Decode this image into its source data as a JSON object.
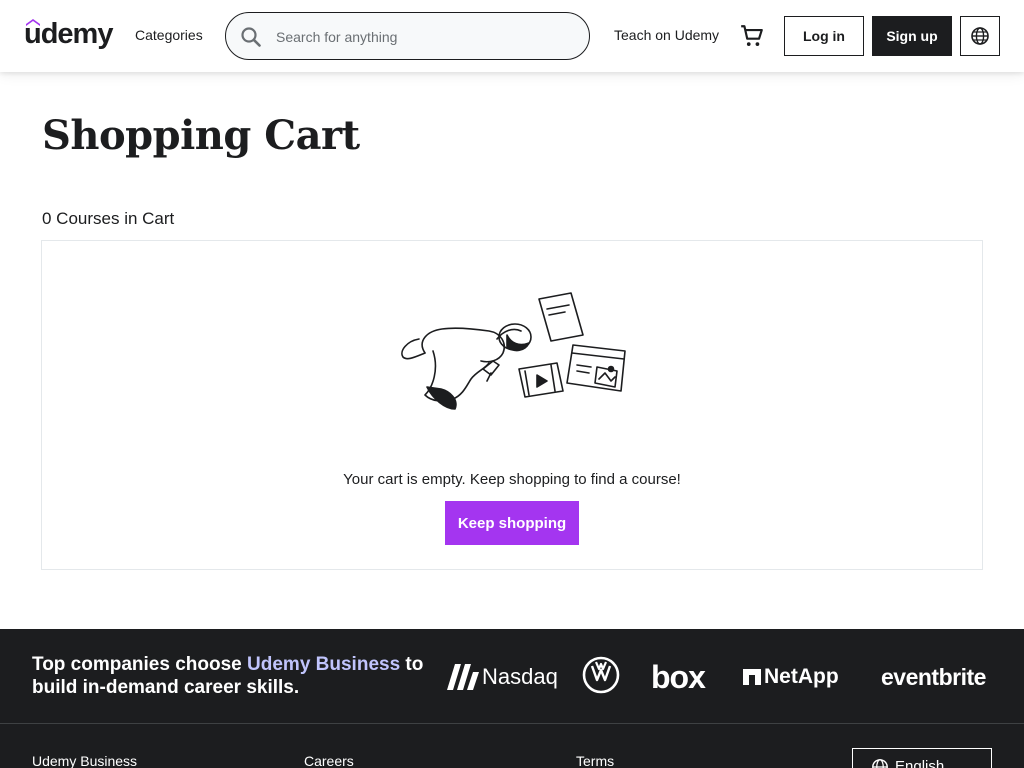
{
  "header": {
    "logo_text": "udemy",
    "nav_categories": "Categories",
    "search_placeholder": "Search for anything",
    "search_value": "",
    "nav_teach": "Teach on Udemy",
    "login_label": "Log in",
    "signup_label": "Sign up",
    "icons": {
      "search": "search-icon",
      "cart": "cart-icon",
      "language": "globe-icon"
    }
  },
  "main": {
    "title": "Shopping Cart",
    "cart_count": "0 Courses in Cart",
    "empty_message": "Your cart is empty. Keep shopping to find a course!",
    "keep_shopping_label": "Keep shopping"
  },
  "footer": {
    "tagline_prefix": "Top companies choose ",
    "tagline_highlight": "Udemy Business",
    "tagline_suffix": " to build in-demand career skills.",
    "partners": [
      "Nasdaq",
      "Volkswagen",
      "box",
      "NetApp",
      "eventbrite"
    ],
    "links": [
      "Udemy Business",
      "Careers",
      "Terms"
    ],
    "language_label": "English"
  },
  "colors": {
    "brand_purple": "#a435f0",
    "text_dark": "#1c1d1f",
    "footer_bg": "#1c1d1f",
    "highlight_lavender": "#c0c4fc"
  }
}
